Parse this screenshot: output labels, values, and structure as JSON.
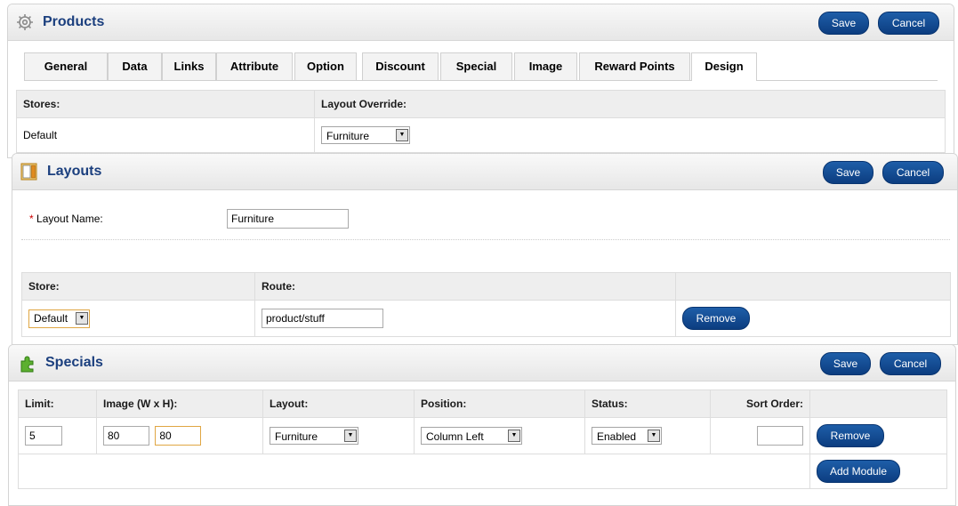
{
  "products": {
    "title": "Products",
    "save_label": "Save",
    "cancel_label": "Cancel",
    "tabs": [
      {
        "label": "General"
      },
      {
        "label": "Data"
      },
      {
        "label": "Links"
      },
      {
        "label": "Attribute"
      },
      {
        "label": "Option"
      },
      {
        "label": "Discount"
      },
      {
        "label": "Special"
      },
      {
        "label": "Image"
      },
      {
        "label": "Reward Points"
      },
      {
        "label": "Design",
        "active": true
      }
    ],
    "design": {
      "stores_header": "Stores:",
      "layout_override_header": "Layout Override:",
      "store_name": "Default",
      "layout_value": "Furniture"
    }
  },
  "layouts": {
    "title": "Layouts",
    "save_label": "Save",
    "cancel_label": "Cancel",
    "required_mark": "*",
    "layout_name_label": "Layout Name:",
    "layout_name_value": "Furniture",
    "store_header": "Store:",
    "route_header": "Route:",
    "row": {
      "store": "Default",
      "route": "product/stuff",
      "remove_label": "Remove"
    }
  },
  "specials": {
    "title": "Specials",
    "save_label": "Save",
    "cancel_label": "Cancel",
    "headers": {
      "limit": "Limit:",
      "image": "Image (W x H):",
      "layout": "Layout:",
      "position": "Position:",
      "status": "Status:",
      "sort_order": "Sort Order:"
    },
    "row": {
      "limit": "5",
      "width": "80",
      "height": "80",
      "layout": "Furniture",
      "position": "Column Left",
      "status": "Enabled",
      "sort_order": "",
      "remove_label": "Remove"
    },
    "add_module_label": "Add Module"
  },
  "icons": {
    "products": "gear-icon",
    "layouts": "layout-icon",
    "specials": "puzzle-icon",
    "dropdown": "dropdown-arrow-icon"
  },
  "colors": {
    "button": "#0c3d80",
    "title": "#1b3f7e",
    "focus_border": "#e0a643",
    "required": "#cc0000"
  }
}
